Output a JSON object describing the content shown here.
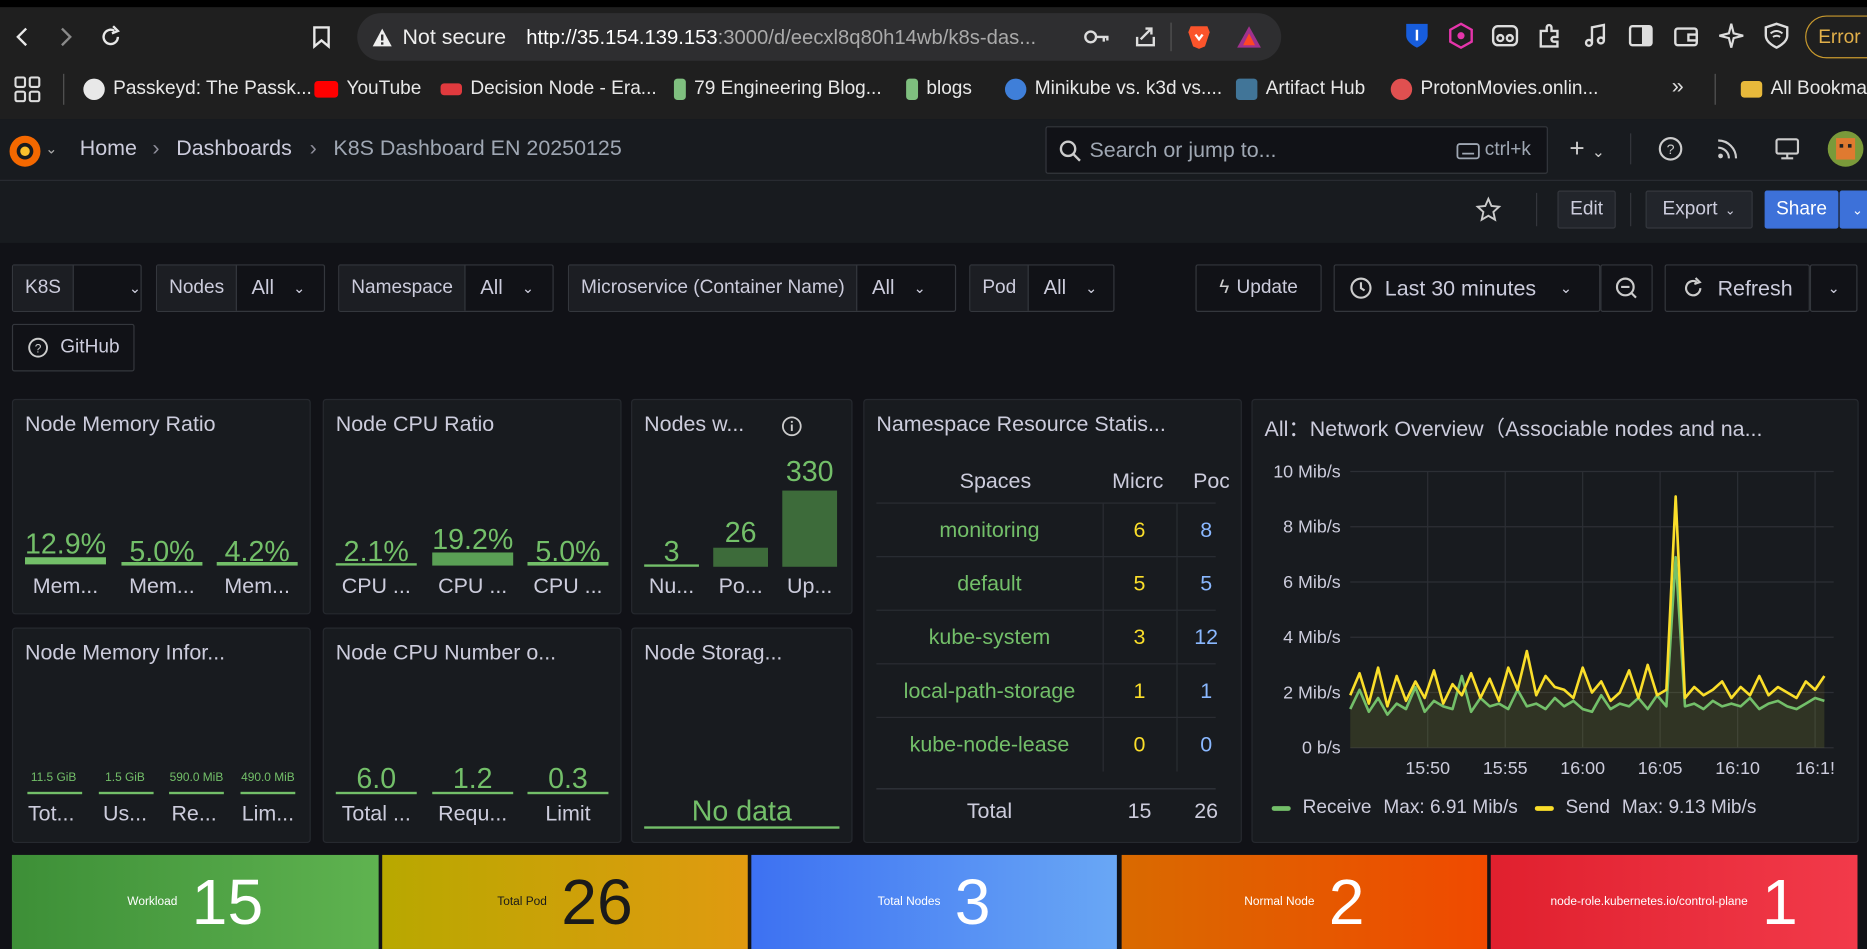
{
  "browser": {
    "security_label": "Not secure",
    "url_host": "http://35.154.139.153",
    "url_rest": ":3000/d/eecxl8q80h14wb/k8s-das...",
    "error_label": "Error",
    "bookmarks": [
      {
        "label": "Passkeyd: The Passk...",
        "color": "#e8e8e8"
      },
      {
        "label": "YouTube",
        "color": "#ff0000"
      },
      {
        "label": "Decision Node - Era...",
        "color": "#e03a3e"
      },
      {
        "label": "79 Engineering Blog...",
        "color": "#7fbf7f"
      },
      {
        "label": "blogs",
        "color": "#7fbf7f"
      },
      {
        "label": "Minikube vs. k3d vs....",
        "color": "#3f7fd9"
      },
      {
        "label": "Artifact Hub",
        "color": "#417598"
      },
      {
        "label": "ProtonMovies.onlin...",
        "color": "#e05050"
      }
    ],
    "all_bookmarks": "All Bookmar"
  },
  "grafana": {
    "breadcrumb": [
      "Home",
      "Dashboards",
      "K8S Dashboard EN 20250125"
    ],
    "search_placeholder": "Search or jump to...",
    "search_shortcut": "ctrl+k",
    "edit_label": "Edit",
    "export_label": "Export",
    "share_label": "Share",
    "update_label": "Update",
    "time_range": "Last 30 minutes",
    "refresh_label": "Refresh",
    "github_label": "GitHub",
    "variables": [
      {
        "label": "K8S",
        "value": ""
      },
      {
        "label": "Nodes",
        "value": "All"
      },
      {
        "label": "Namespace",
        "value": "All"
      },
      {
        "label": "Microservice (Container Name)",
        "value": "All"
      },
      {
        "label": "Pod",
        "value": "All"
      }
    ]
  },
  "panels": {
    "mem_ratio": {
      "title": "Node Memory Ratio",
      "items": [
        {
          "value": "12.9%",
          "label": "Mem..."
        },
        {
          "value": "5.0%",
          "label": "Mem..."
        },
        {
          "value": "4.2%",
          "label": "Mem..."
        }
      ]
    },
    "cpu_ratio": {
      "title": "Node CPU Ratio",
      "items": [
        {
          "value": "2.1%",
          "label": "CPU ..."
        },
        {
          "value": "19.2%",
          "label": "CPU ..."
        },
        {
          "value": "5.0%",
          "label": "CPU ..."
        }
      ]
    },
    "nodes_w": {
      "title": "Nodes w...",
      "items": [
        {
          "value": "3",
          "label": "Nu..."
        },
        {
          "value": "26",
          "label": "Po..."
        },
        {
          "value": "330",
          "label": "Up..."
        }
      ]
    },
    "mem_info": {
      "title": "Node Memory Infor...",
      "items": [
        {
          "value": "11.5 GiB",
          "label": "Tot..."
        },
        {
          "value": "1.5 GiB",
          "label": "Us..."
        },
        {
          "value": "590.0 MiB",
          "label": "Re..."
        },
        {
          "value": "490.0 MiB",
          "label": "Lim..."
        }
      ]
    },
    "cpu_number": {
      "title": "Node CPU Number o...",
      "items": [
        {
          "value": "6.0",
          "label": "Total ..."
        },
        {
          "value": "1.2",
          "label": "Requ..."
        },
        {
          "value": "0.3",
          "label": "Limit"
        }
      ]
    },
    "storage": {
      "title": "Node Storag...",
      "no_data": "No data"
    },
    "namespace": {
      "title": "Namespace Resource Statis...",
      "headers": [
        "Spaces",
        "Micrc",
        "Poc"
      ],
      "rows": [
        {
          "name": "monitoring",
          "micro": "6",
          "pods": "8"
        },
        {
          "name": "default",
          "micro": "5",
          "pods": "5"
        },
        {
          "name": "kube-system",
          "micro": "3",
          "pods": "12"
        },
        {
          "name": "local-path-storage",
          "micro": "1",
          "pods": "1"
        },
        {
          "name": "kube-node-lease",
          "micro": "0",
          "pods": "0"
        }
      ],
      "total": {
        "label": "Total",
        "micro": "15",
        "pods": "26"
      }
    },
    "network": {
      "title": "All：Network Overview（Associable nodes and na...",
      "legend": [
        {
          "name": "Receive",
          "max": "Max: 6.91 Mib/s",
          "color": "#73bf69"
        },
        {
          "name": "Send",
          "max": "Max: 9.13 Mib/s",
          "color": "#fade2a"
        }
      ]
    }
  },
  "stats": [
    {
      "label": "Workload",
      "value": "15",
      "color_a": "#3d8f37",
      "color_b": "#5fb350"
    },
    {
      "label": "Total Pod",
      "value": "26",
      "color_a": "#b8a800",
      "color_b": "#e09a10"
    },
    {
      "label": "Total Nodes",
      "value": "3",
      "color_a": "#3d71f2",
      "color_b": "#69a7f5"
    },
    {
      "label": "Normal Node",
      "value": "2",
      "color_a": "#d96a00",
      "color_b": "#f04a00"
    },
    {
      "label": "node-role.kubernetes.io/control-plane",
      "value": "1",
      "color_a": "#e0202e",
      "color_b": "#f23a4a"
    }
  ],
  "chart_data": {
    "type": "line",
    "title": "All：Network Overview（Associable nodes and na...",
    "ylabel": "",
    "ylim": [
      0,
      10
    ],
    "y_ticks": [
      "0 b/s",
      "2 Mib/s",
      "4 Mib/s",
      "6 Mib/s",
      "8 Mib/s",
      "10 Mib/s"
    ],
    "x_ticks": [
      "15:50",
      "15:55",
      "16:00",
      "16:05",
      "16:10",
      "16:1!"
    ],
    "x_range": [
      15.75,
      16.27
    ],
    "series": [
      {
        "name": "Receive",
        "color": "#73bf69",
        "x": [
          15.75,
          15.76,
          15.77,
          15.78,
          15.79,
          15.8,
          15.81,
          15.82,
          15.83,
          15.84,
          15.85,
          15.86,
          15.87,
          15.88,
          15.89,
          15.9,
          15.91,
          15.92,
          15.93,
          15.94,
          15.95,
          15.96,
          15.97,
          15.98,
          15.99,
          16.0,
          16.01,
          16.02,
          16.03,
          16.04,
          16.05,
          16.06,
          16.07,
          16.08,
          16.09,
          16.1,
          16.11,
          16.12,
          16.13,
          16.14,
          16.15,
          16.16,
          16.17,
          16.18,
          16.19,
          16.2,
          16.21,
          16.22,
          16.23,
          16.24,
          16.25,
          16.26
        ],
        "y": [
          1.4,
          2.1,
          1.3,
          1.8,
          1.2,
          1.6,
          1.4,
          2.2,
          1.3,
          1.7,
          1.5,
          1.4,
          2.6,
          1.3,
          1.8,
          1.5,
          1.6,
          1.4,
          2.1,
          1.5,
          1.6,
          1.4,
          1.8,
          1.5,
          1.7,
          1.4,
          1.3,
          1.9,
          1.4,
          1.6,
          1.5,
          1.8,
          1.4,
          1.9,
          1.5,
          6.9,
          1.5,
          1.6,
          1.4,
          1.7,
          1.5,
          1.6,
          1.5,
          1.8,
          1.4,
          1.6,
          1.7,
          1.5,
          1.4,
          1.6,
          1.8,
          1.7
        ]
      },
      {
        "name": "Send",
        "color": "#fade2a",
        "x": [
          15.75,
          15.76,
          15.77,
          15.78,
          15.79,
          15.8,
          15.81,
          15.82,
          15.83,
          15.84,
          15.85,
          15.86,
          15.87,
          15.88,
          15.89,
          15.9,
          15.91,
          15.92,
          15.93,
          15.94,
          15.95,
          15.96,
          15.97,
          15.98,
          15.99,
          16.0,
          16.01,
          16.02,
          16.03,
          16.04,
          16.05,
          16.06,
          16.07,
          16.08,
          16.09,
          16.1,
          16.11,
          16.12,
          16.13,
          16.14,
          16.15,
          16.16,
          16.17,
          16.18,
          16.19,
          16.2,
          16.21,
          16.22,
          16.23,
          16.24,
          16.25,
          16.26
        ],
        "y": [
          1.9,
          2.7,
          1.6,
          2.9,
          1.5,
          2.6,
          1.7,
          2.4,
          1.8,
          2.8,
          1.6,
          2.3,
          1.9,
          2.7,
          1.8,
          2.5,
          1.7,
          2.9,
          2.1,
          3.5,
          1.9,
          2.6,
          2.2,
          2.1,
          1.8,
          2.9,
          2.0,
          2.4,
          1.7,
          2.0,
          2.8,
          1.8,
          3.0,
          1.9,
          2.1,
          9.1,
          1.8,
          2.2,
          1.9,
          2.1,
          2.4,
          1.8,
          2.2,
          1.9,
          2.6,
          1.9,
          2.2,
          2.0,
          1.8,
          2.4,
          2.1,
          2.6
        ]
      }
    ]
  }
}
